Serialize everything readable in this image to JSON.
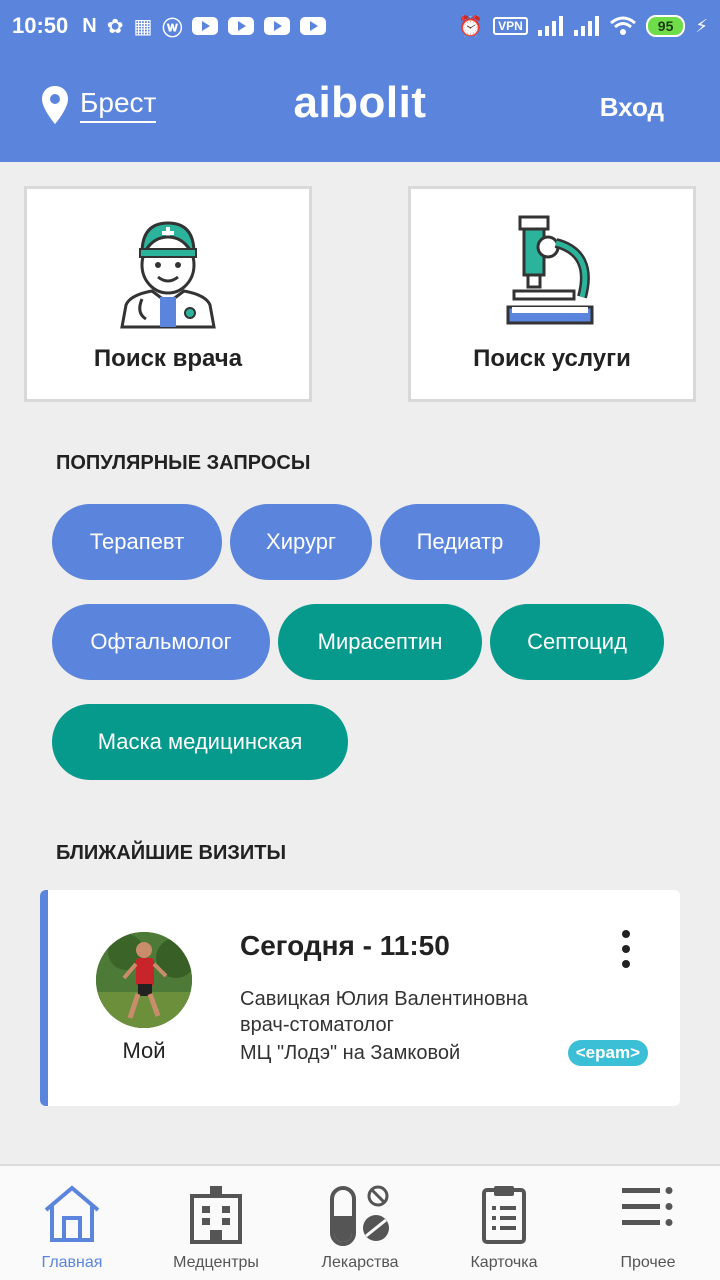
{
  "status_bar": {
    "time": "10:50",
    "vpn": "VPN",
    "battery": "95"
  },
  "header": {
    "city": "Брест",
    "brand": "aibolit",
    "login": "Вход"
  },
  "search_cards": [
    {
      "label": "Поиск врача",
      "icon": "doctor-icon"
    },
    {
      "label": "Поиск услуги",
      "icon": "microscope-icon"
    }
  ],
  "popular": {
    "title": "ПОПУЛЯРНЫЕ ЗАПРОСЫ",
    "chips": [
      {
        "label": "Терапевт",
        "color": "#5b85dc"
      },
      {
        "label": "Хирург",
        "color": "#5b85dc"
      },
      {
        "label": "Педиатр",
        "color": "#5b85dc"
      },
      {
        "label": "Офтальмолог",
        "color": "#5b85dc"
      },
      {
        "label": "Мирасептин",
        "color": "#069a8c"
      },
      {
        "label": "Септоцид",
        "color": "#069a8c"
      },
      {
        "label": "Маска медицинская",
        "color": "#069a8c"
      }
    ]
  },
  "visits": {
    "title": "БЛИЖАЙШИЕ ВИЗИТЫ",
    "items": [
      {
        "patient": "Мой",
        "when": "Сегодня - 11:50",
        "doctor": "Савицкая Юлия Валентиновна",
        "specialty": "врач-стоматолог",
        "clinic": "МЦ \"Лодэ\" на Замковой",
        "badge": "<epam>"
      }
    ]
  },
  "bottom_nav": [
    {
      "label": "Главная",
      "icon": "home-icon",
      "active": true
    },
    {
      "label": "Медцентры",
      "icon": "hospital-icon",
      "active": false
    },
    {
      "label": "Лекарства",
      "icon": "pills-icon",
      "active": false
    },
    {
      "label": "Карточка",
      "icon": "clipboard-icon",
      "active": false
    },
    {
      "label": "Прочее",
      "icon": "menu-icon",
      "active": false
    }
  ],
  "colors": {
    "primary": "#5b85dc",
    "accent": "#069a8c",
    "background": "#eeeeee"
  }
}
